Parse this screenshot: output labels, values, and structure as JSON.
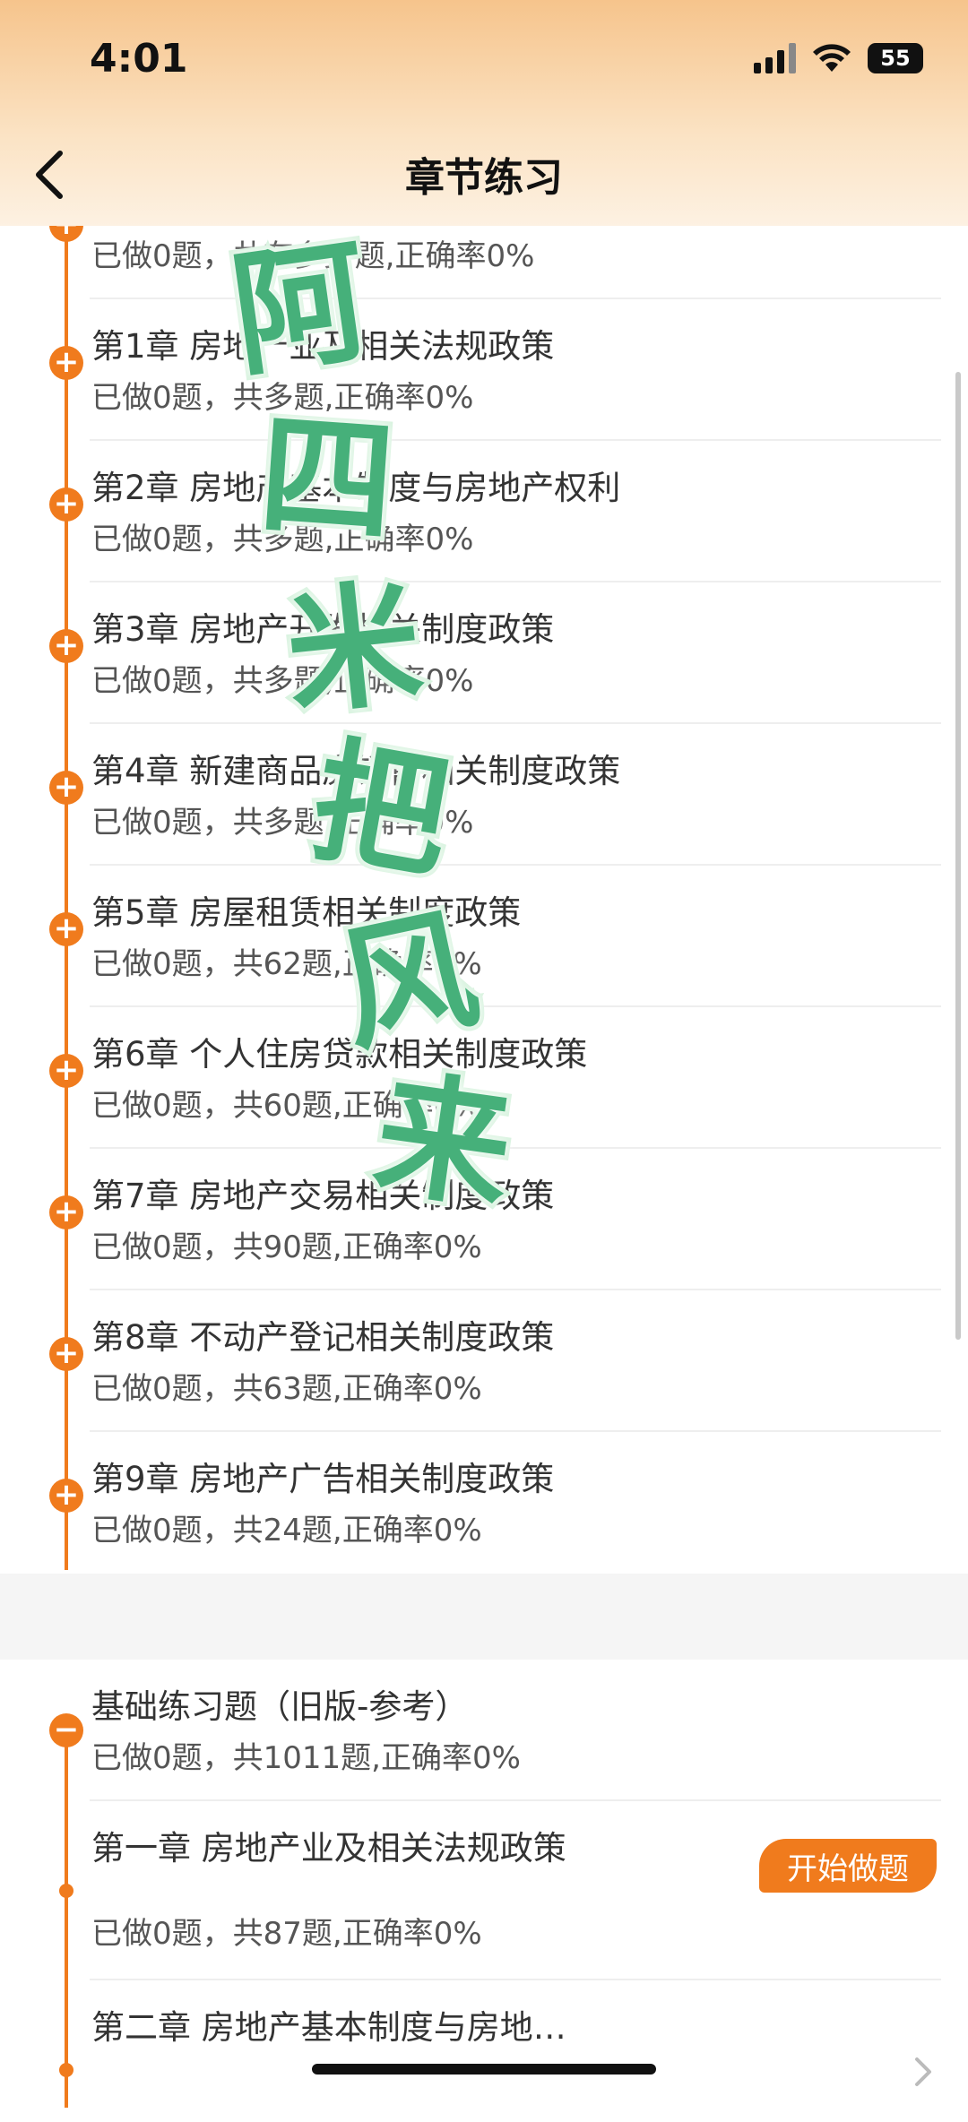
{
  "status_bar": {
    "time": "4:01",
    "battery": "55"
  },
  "header": {
    "title": "章节练习"
  },
  "section1": {
    "top_partial_sub": "已做0题，共有多少题,正确率0%",
    "chapters": [
      {
        "title": "第1章  房地产业及相关法规政策",
        "sub": "已做0题，共多题,正确率0%"
      },
      {
        "title": "第2章  房地产基本制度与房地产权利",
        "sub": "已做0题，共多题,正确率0%"
      },
      {
        "title": "第3章  房地产开发相关制度政策",
        "sub": "已做0题，共多题,正确率0%"
      },
      {
        "title": "第4章  新建商品房销售相关制度政策",
        "sub": "已做0题，共多题,正确率0%"
      },
      {
        "title": "第5章  房屋租赁相关制度政策",
        "sub": "已做0题，共62题,正确率0%"
      },
      {
        "title": "第6章  个人住房贷款相关制度政策",
        "sub": "已做0题，共60题,正确率0%"
      },
      {
        "title": "第7章  房地产交易相关制度政策",
        "sub": "已做0题，共90题,正确率0%"
      },
      {
        "title": "第8章  不动产登记相关制度政策",
        "sub": "已做0题，共63题,正确率0%"
      },
      {
        "title": "第9章  房地产广告相关制度政策",
        "sub": "已做0题，共24题,正确率0%"
      }
    ]
  },
  "section2": {
    "title": "基础练习题（旧版-参考）",
    "sub": "已做0题，共1011题,正确率0%",
    "chapters": [
      {
        "title": "第一章    房地产业及相关法规政策",
        "sub": "已做0题，共87题,正确率0%",
        "button": "开始做题"
      },
      {
        "title": "第二章    房地产基本制度与房地…",
        "sub": ""
      }
    ]
  },
  "sticker_text": [
    "阿",
    "四",
    "米",
    "把",
    "风",
    "来"
  ],
  "colors": {
    "accent": "#f07b1d",
    "sticker": "#46b07a"
  },
  "icons": [
    "back-chevron-icon",
    "plus-circle-icon",
    "minus-circle-icon",
    "chevron-right-icon",
    "wifi-icon",
    "signal-icon",
    "battery-icon"
  ]
}
